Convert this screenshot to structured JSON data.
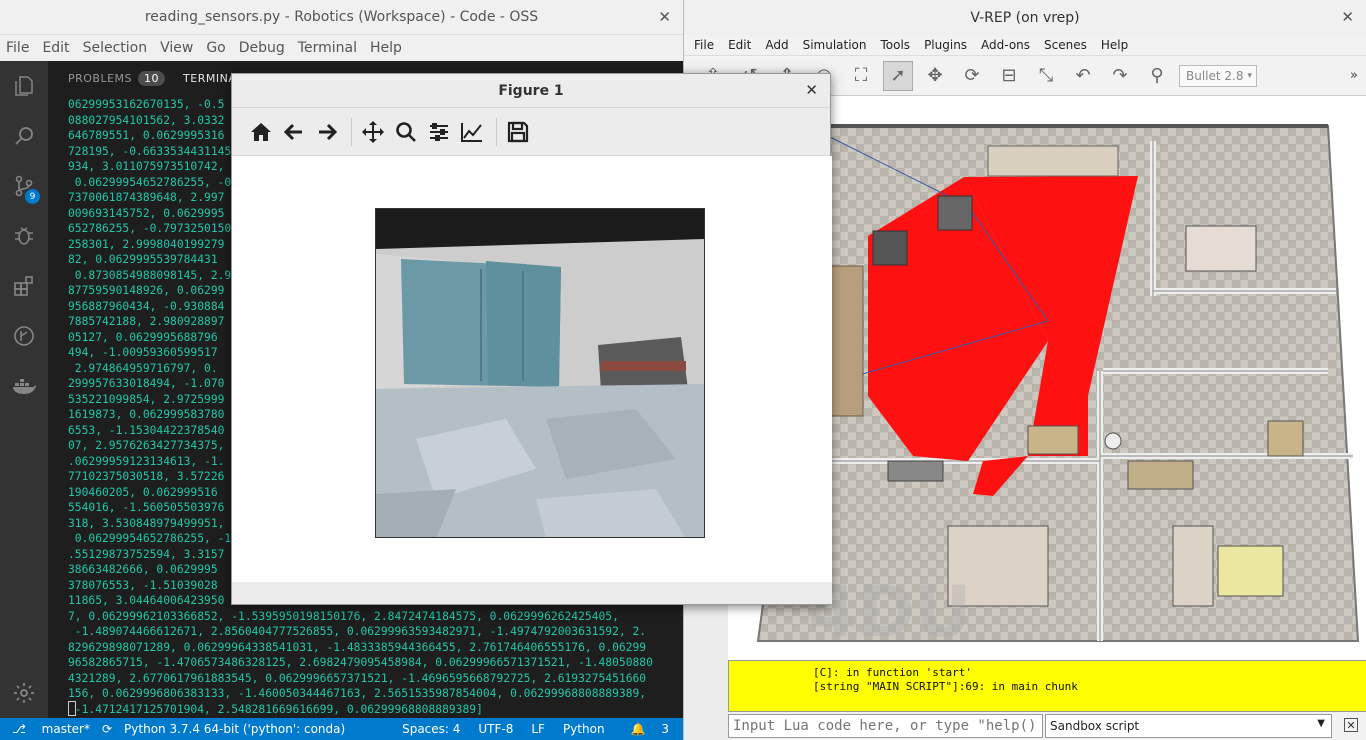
{
  "vscode": {
    "title": "reading_sensors.py - Robotics (Workspace) - Code - OSS",
    "menu": [
      "File",
      "Edit",
      "Selection",
      "View",
      "Go",
      "Debug",
      "Terminal",
      "Help"
    ],
    "activity_badge": "9",
    "panel": {
      "problems_label": "PROBLEMS",
      "problems_count": "10",
      "terminal_label": "TERMINAL"
    },
    "terminal_lines": [
      "06299953162670135, -0.5",
      "088027954101562, 3.0332",
      "646789551, 0.0629995316",
      "728195, -0.6633534431145",
      "934, 3.011075973510742,",
      " 0.06299954652786255, -0",
      "7370061874389648, 2.997",
      "009693145752, 0.0629995",
      "652786255, -0.7973250150",
      "258301, 2.9998040199279",
      "82, 0.0629995539784431",
      " 0.8730854988098145, 2.9",
      "87759590148926, 0.06299",
      "956887960434, -0.930884",
      "7885742188, 2.980928897",
      "05127, 0.0629995688796",
      "494, -1.00959360599517",
      " 2.974864959716797, 0.",
      "299957633018494, -1.070",
      "535221099854, 2.9725999",
      "1619873, 0.062999583780",
      "6553, -1.15304422378540",
      "07, 2.9576263427734375,",
      ".06299959123134613, -1.",
      "77102375030518, 3.57226",
      "190460205, 0.062999516",
      "554016, -1.560505503976",
      "318, 3.530848979499951,",
      " 0.06299954652786255, -1",
      ".55129873752594, 3.3157",
      "38663482666, 0.0629995",
      "378076553, -1.51039028",
      "11865, 3.04464006423950",
      "7, 0.06299962103366852, -1.5395950198150176, 2.8472474184575, 0.0629996262425405,",
      " -1.489074466612671, 2.8560404777526855, 0.06299963593482971, -1.4974792003631592, 2.",
      "829629898071289, 0.06299964338541031, -1.4833385944366455, 2.761746406555176, 0.06299",
      "96582865715, -1.4706573486328125, 2.6982479095458984, 0.06299966571371521, -1.48050880",
      "4321289, 2.6770617961883545, 0.0629996657371521, -1.4696595668792725, 2.6193275451660",
      "156, 0.0629996806383133, -1.460050344467163, 2.5651535987854004, 0.06299968808889389,",
      " -1.4712417125701904, 2.548281669616699, 0.06299968808889389]"
    ],
    "status": {
      "branch": "master*",
      "interpreter": "Python 3.7.4 64-bit ('python': conda)",
      "spaces": "Spaces: 4",
      "encoding": "UTF-8",
      "eol": "LF",
      "language": "Python",
      "notifications": "3"
    }
  },
  "figure": {
    "title": "Figure 1"
  },
  "vrep": {
    "title": "V-REP (on vrep)",
    "menu": [
      "File",
      "Edit",
      "Add",
      "Simulation",
      "Tools",
      "Plugins",
      "Add-ons",
      "Scenes",
      "Help"
    ],
    "physics_engine": "Bullet 2.8",
    "console_lines": [
      "[C]: in function 'start'",
      "[string \"MAIN SCRIPT\"]:69: in main chunk"
    ],
    "lua_placeholder": "Input Lua code here, or type \"help()\" (use TAB for auto-completion)",
    "script_selector": "Sandbox script"
  }
}
